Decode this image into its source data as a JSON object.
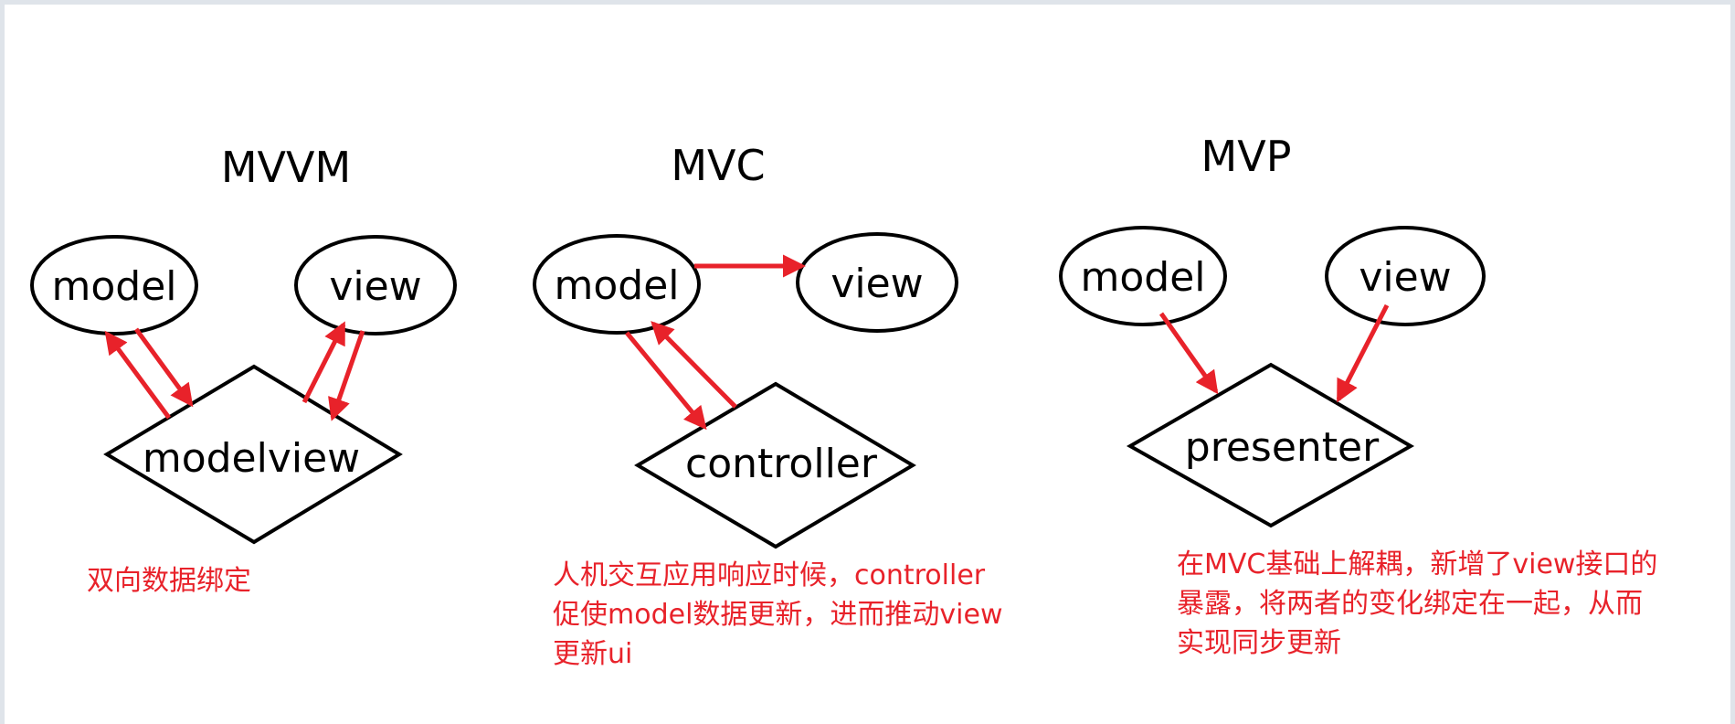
{
  "colors": {
    "arrow": "#e8222a",
    "note": "#e8222a",
    "shape_stroke": "#000000",
    "frame": "#dfe4ea"
  },
  "patterns": {
    "mvvm": {
      "title": "MVVM",
      "model": "model",
      "view": "view",
      "modelview": "modelview",
      "note": "双向数据绑定"
    },
    "mvc": {
      "title": "MVC",
      "model": "model",
      "view": "view",
      "controller": "controller",
      "note": "人机交互应用响应时候，controller\n促使model数据更新，进而推动view\n更新ui"
    },
    "mvp": {
      "title": "MVP",
      "model": "model",
      "view": "view",
      "presenter": "presenter",
      "note": "在MVC基础上解耦，新增了view接口的\n暴露，将两者的变化绑定在一起，从而\n实现同步更新"
    }
  }
}
